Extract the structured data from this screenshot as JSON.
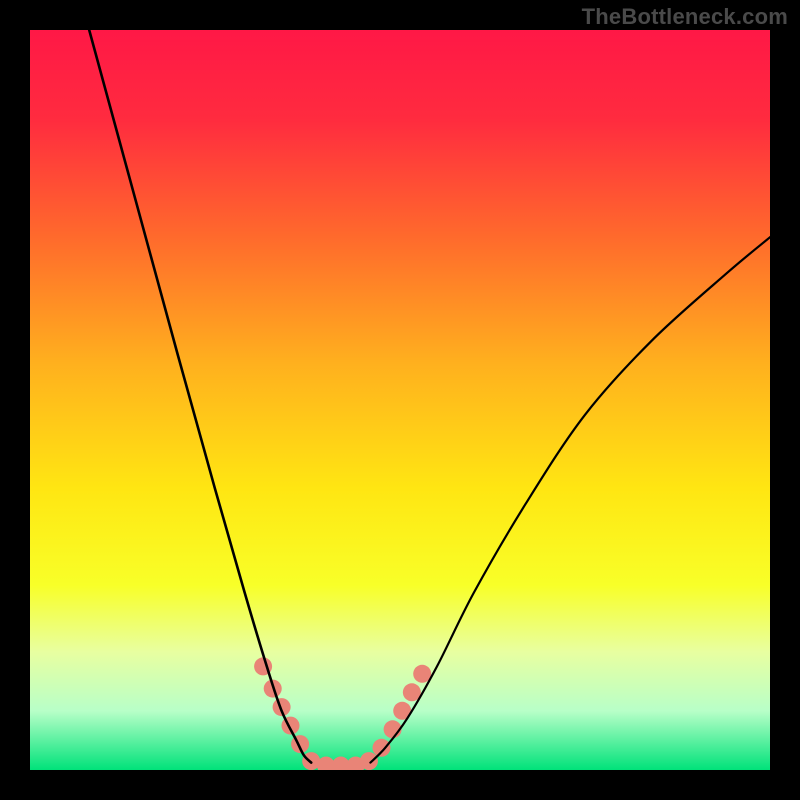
{
  "watermark": "TheBottleneck.com",
  "chart_data": {
    "type": "line",
    "xlim": [
      0,
      100
    ],
    "ylim": [
      0,
      100
    ],
    "background": {
      "gradient_stops": [
        {
          "pos": 0.0,
          "color": "#ff1846"
        },
        {
          "pos": 0.12,
          "color": "#ff2b3f"
        },
        {
          "pos": 0.28,
          "color": "#ff6a2c"
        },
        {
          "pos": 0.45,
          "color": "#ffb01e"
        },
        {
          "pos": 0.62,
          "color": "#ffe612"
        },
        {
          "pos": 0.75,
          "color": "#f8ff28"
        },
        {
          "pos": 0.84,
          "color": "#e8ffa0"
        },
        {
          "pos": 0.92,
          "color": "#b8ffc8"
        },
        {
          "pos": 1.0,
          "color": "#00e27a"
        }
      ]
    },
    "series": [
      {
        "name": "left-arm",
        "x": [
          8,
          14,
          20,
          25,
          29,
          32,
          34,
          36,
          37,
          38
        ],
        "y": [
          100,
          78,
          56,
          38,
          24,
          14,
          8,
          4,
          2,
          1
        ],
        "stroke": "#000000",
        "stroke_width": 2.6
      },
      {
        "name": "right-arm",
        "x": [
          46,
          48,
          51,
          55,
          60,
          67,
          75,
          84,
          94,
          100
        ],
        "y": [
          1,
          3,
          7,
          14,
          24,
          36,
          48,
          58,
          67,
          72
        ],
        "stroke": "#000000",
        "stroke_width": 2.2
      }
    ],
    "markers": {
      "name": "highlight-beads",
      "points": [
        {
          "x": 31.5,
          "y": 14
        },
        {
          "x": 32.8,
          "y": 11
        },
        {
          "x": 34.0,
          "y": 8.5
        },
        {
          "x": 35.2,
          "y": 6
        },
        {
          "x": 36.5,
          "y": 3.5
        },
        {
          "x": 38.0,
          "y": 1.2
        },
        {
          "x": 40.0,
          "y": 0.6
        },
        {
          "x": 42.0,
          "y": 0.6
        },
        {
          "x": 44.0,
          "y": 0.6
        },
        {
          "x": 45.8,
          "y": 1.2
        },
        {
          "x": 47.5,
          "y": 3.0
        },
        {
          "x": 49.0,
          "y": 5.5
        },
        {
          "x": 50.3,
          "y": 8.0
        },
        {
          "x": 51.6,
          "y": 10.5
        },
        {
          "x": 53.0,
          "y": 13.0
        }
      ],
      "radius": 9,
      "color": "#e98477"
    }
  }
}
